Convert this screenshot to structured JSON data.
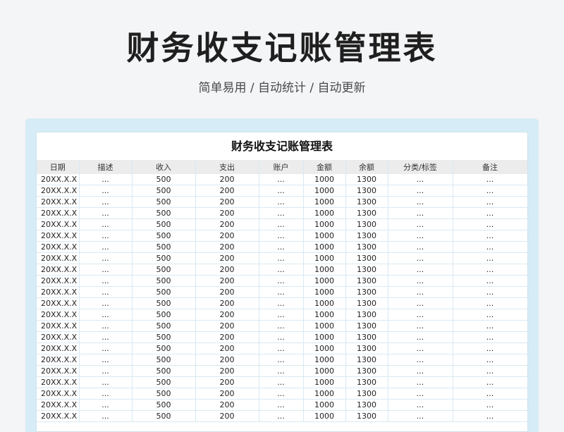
{
  "header": {
    "title": "财务收支记账管理表",
    "subtitle": "简单易用 / 自动统计 / 自动更新"
  },
  "sheet": {
    "title": "财务收支记账管理表",
    "columns": [
      "日期",
      "描述",
      "收入",
      "支出",
      "账户",
      "金额",
      "余额",
      "分类/标签",
      "备注"
    ],
    "rows": [
      [
        "20XX.X.X",
        "...",
        "500",
        "200",
        "...",
        "1000",
        "1300",
        "...",
        "..."
      ],
      [
        "20XX.X.X",
        "...",
        "500",
        "200",
        "...",
        "1000",
        "1300",
        "...",
        "..."
      ],
      [
        "20XX.X.X",
        "...",
        "500",
        "200",
        "...",
        "1000",
        "1300",
        "...",
        "..."
      ],
      [
        "20XX.X.X",
        "...",
        "500",
        "200",
        "...",
        "1000",
        "1300",
        "...",
        "..."
      ],
      [
        "20XX.X.X",
        "...",
        "500",
        "200",
        "...",
        "1000",
        "1300",
        "...",
        "..."
      ],
      [
        "20XX.X.X",
        "...",
        "500",
        "200",
        "...",
        "1000",
        "1300",
        "...",
        "..."
      ],
      [
        "20XX.X.X",
        "...",
        "500",
        "200",
        "...",
        "1000",
        "1300",
        "...",
        "..."
      ],
      [
        "20XX.X.X",
        "...",
        "500",
        "200",
        "...",
        "1000",
        "1300",
        "...",
        "..."
      ],
      [
        "20XX.X.X",
        "...",
        "500",
        "200",
        "...",
        "1000",
        "1300",
        "...",
        "..."
      ],
      [
        "20XX.X.X",
        "...",
        "500",
        "200",
        "...",
        "1000",
        "1300",
        "...",
        "..."
      ],
      [
        "20XX.X.X",
        "...",
        "500",
        "200",
        "...",
        "1000",
        "1300",
        "...",
        "..."
      ],
      [
        "20XX.X.X",
        "...",
        "500",
        "200",
        "...",
        "1000",
        "1300",
        "...",
        "..."
      ],
      [
        "20XX.X.X",
        "...",
        "500",
        "200",
        "...",
        "1000",
        "1300",
        "...",
        "..."
      ],
      [
        "20XX.X.X",
        "...",
        "500",
        "200",
        "...",
        "1000",
        "1300",
        "...",
        "..."
      ],
      [
        "20XX.X.X",
        "...",
        "500",
        "200",
        "...",
        "1000",
        "1300",
        "...",
        "..."
      ],
      [
        "20XX.X.X",
        "...",
        "500",
        "200",
        "...",
        "1000",
        "1300",
        "...",
        "..."
      ],
      [
        "20XX.X.X",
        "...",
        "500",
        "200",
        "...",
        "1000",
        "1300",
        "...",
        "..."
      ],
      [
        "20XX.X.X",
        "...",
        "500",
        "200",
        "...",
        "1000",
        "1300",
        "...",
        "..."
      ],
      [
        "20XX.X.X",
        "...",
        "500",
        "200",
        "...",
        "1000",
        "1300",
        "...",
        "..."
      ],
      [
        "20XX.X.X",
        "...",
        "500",
        "200",
        "...",
        "1000",
        "1300",
        "...",
        "..."
      ],
      [
        "20XX.X.X",
        "...",
        "500",
        "200",
        "...",
        "1000",
        "1300",
        "...",
        "..."
      ],
      [
        "20XX.X.X",
        "...",
        "500",
        "200",
        "...",
        "1000",
        "1300",
        "...",
        "..."
      ]
    ]
  },
  "colors": {
    "background": "#f4f5f7",
    "frame": "#d6ecf6",
    "header_row": "#ececec",
    "grid_line": "#d9e9f2"
  }
}
